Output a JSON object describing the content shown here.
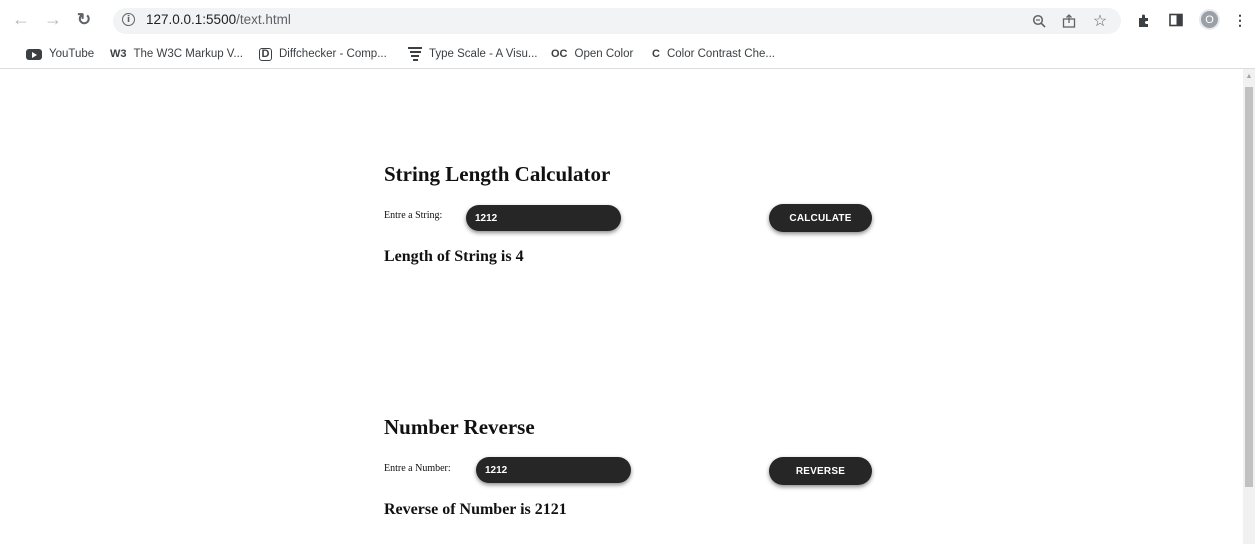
{
  "browser": {
    "url_host": "127.0.0.1:5500",
    "url_path": "/text.html",
    "profile_initial": "O"
  },
  "bookmarks": [
    {
      "label": "YouTube",
      "icon": "youtube-icon"
    },
    {
      "label": "The W3C Markup V...",
      "icon": "w3c-icon",
      "icon_text": "W3"
    },
    {
      "label": "Diffchecker - Comp...",
      "icon": "diffchecker-icon",
      "icon_text": "D"
    },
    {
      "label": "Type Scale - A Visu...",
      "icon": "type-scale-icon"
    },
    {
      "label": "Open Color",
      "icon": "open-color-icon",
      "icon_text": "OC"
    },
    {
      "label": "Color Contrast Che...",
      "icon": "color-contrast-icon",
      "icon_text": "C"
    }
  ],
  "string_section": {
    "title": "String Length Calculator",
    "input_label": "Entre a String:",
    "input_value": "1212",
    "button_label": "CALCULATE",
    "result": "Length of String is 4"
  },
  "number_section": {
    "title": "Number Reverse",
    "input_label": "Entre a Number:",
    "input_value": "1212",
    "button_label": "REVERSE",
    "result": "Reverse of Number is 2121"
  },
  "colors": {
    "pill_background": "#262626",
    "pill_text": "#ffffff",
    "page_background": "#ffffff"
  }
}
